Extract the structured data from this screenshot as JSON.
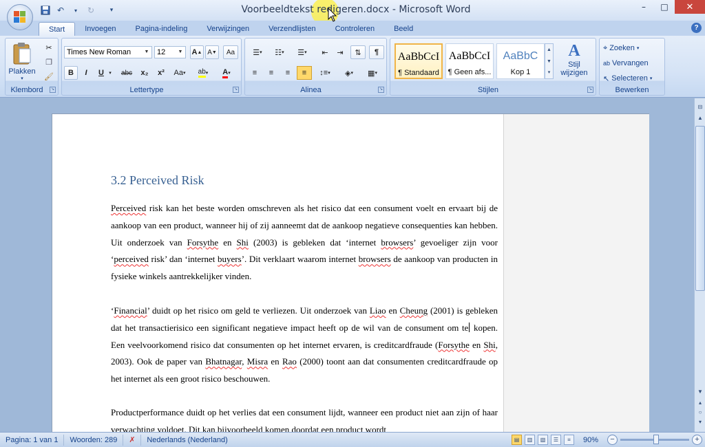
{
  "window": {
    "title": "Voorbeeldtekst redigeren.docx - Microsoft Word",
    "controls": {
      "minimize": "–",
      "maximize": "□",
      "close": "✕"
    }
  },
  "qat": {
    "save": "💾",
    "undo": "↶",
    "redo": "↻",
    "customize": "▾"
  },
  "tabs": [
    "Start",
    "Invoegen",
    "Pagina-indeling",
    "Verwijzingen",
    "Verzendlijsten",
    "Controleren",
    "Beeld"
  ],
  "ribbon": {
    "clipboard": {
      "label": "Klembord",
      "paste": "Plakken"
    },
    "font": {
      "label": "Lettertype",
      "family": "Times New Roman",
      "size": "12",
      "bold": "B",
      "italic": "I",
      "underline": "U",
      "strike": "abc",
      "subscript": "x₂",
      "superscript": "x²",
      "case": "Aa",
      "grow": "A↑",
      "shrink": "A↓",
      "highlight": "ab",
      "color": "A"
    },
    "paragraph": {
      "label": "Alinea"
    },
    "styles": {
      "label": "Stijlen",
      "items": [
        {
          "sample": "AaBbCcI",
          "name": "¶ Standaard"
        },
        {
          "sample": "AaBbCcI",
          "name": "¶ Geen afs..."
        },
        {
          "sample": "AaBbC",
          "name": "Kop 1"
        }
      ],
      "change": "Stijl wijzigen"
    },
    "editing": {
      "label": "Bewerken",
      "find": "Zoeken",
      "replace": "Vervangen",
      "select": "Selecteren"
    }
  },
  "document": {
    "heading": "3.2 Perceived Risk",
    "p1": {
      "a": "Perceived",
      "b": " risk kan het beste worden omschreven als het risico dat een consument voelt en ervaart bij de aankoop van een product, wanneer hij of zij aanneemt dat de aankoop negatieve consequenties kan hebben. Uit onderzoek van ",
      "c": "Forsythe",
      "d": " en ",
      "e": "Shi",
      "f": " (2003) is gebleken dat ‘internet ",
      "g": "browsers",
      "h": "’ gevoeliger zijn voor ‘",
      "i": "perceived",
      "j": " risk’ dan ‘internet ",
      "k": "buyers",
      "l": "’. Dit verklaart waarom internet ",
      "m": "browsers",
      "n": " de aankoop van producten in fysieke winkels aantrekkelijker vinden."
    },
    "p2": {
      "a": "‘",
      "b": "Financial",
      "c": "’ duidt op het risico om geld te verliezen. Uit onderzoek van ",
      "d": "Liao",
      "e": " en ",
      "f": "Cheung",
      "g": " (2001) is gebleken dat het transactierisico een significant negatieve impact heeft op de wil van de consument om te",
      "h": " kopen. Een veelvoorkomend risico dat consumenten op het internet ervaren, is creditcardfraude (",
      "i": "Forsythe",
      "j": " en ",
      "k": "Shi",
      "l": ", 2003). Ook de paper van ",
      "m": "Bhatnagar",
      "n": ", ",
      "o": "Misra",
      "p": " en ",
      "q": "Rao",
      "r": " (2000) toont aan dat consumenten creditcardfraude op het internet als een groot risico beschouwen."
    },
    "p3": "Productperformance duidt op het verlies dat een consument lijdt, wanneer een product niet aan zijn of haar verwachting voldoet. Dit kan bijvoorbeeld komen doordat een product wordt"
  },
  "statusbar": {
    "page": "Pagina: 1 van 1",
    "words": "Woorden: 289",
    "language": "Nederlands (Nederland)",
    "zoom": "90%",
    "zoom_minus": "−",
    "zoom_plus": "+"
  }
}
